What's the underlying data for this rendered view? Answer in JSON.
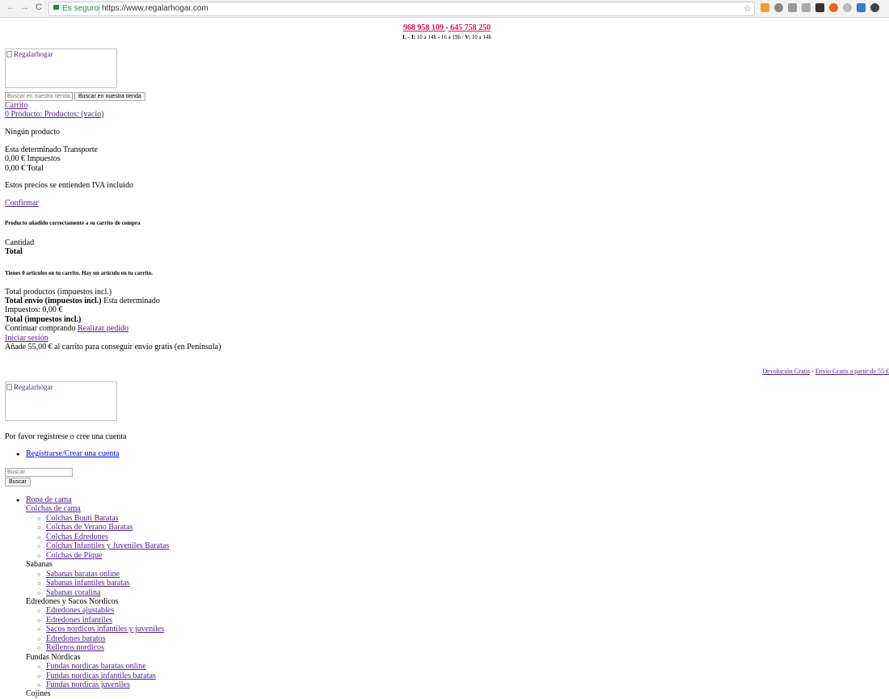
{
  "browser": {
    "secure_label": "Es seguro",
    "url": "https://www.regalarhogar.com",
    "nav_back": "←",
    "nav_forward": "→",
    "nav_reload": "C"
  },
  "header": {
    "phone1": "968 958 109 ",
    "phone_sep": "-",
    "phone2": " 645 758 250 ",
    "hours_lj_label": "L - J:",
    "hours_lj": " 10 a 14h - 16 a 19h / ",
    "hours_v_label": "V:",
    "hours_v": " 10 a 14h"
  },
  "logo_alt": "Regalarhogar",
  "search_top": {
    "placeholder": "Buscar en nuestra tienda",
    "button": "Buscar en nuestra tienda"
  },
  "cart": {
    "title": "Carrito",
    "summary": "0 Producto: Productos: (vacío)",
    "empty": "Ningún producto",
    "shipping": "Esta determinado Transporte",
    "taxes": "0,00 € Impuestos",
    "total": "0,00 € Total",
    "iva_note": "Estos precios se entienden IVA incluído",
    "confirm": "Confirmar"
  },
  "layer": {
    "added": "Producto añadido correctamente a su carrito de compra",
    "quantity": "Cantidad",
    "total": "Total",
    "items_msg": "Tienes 0 artículos en tu carrito. Hay un artículo en tu carrito.",
    "total_products": "Total productos (impuestos incl.)",
    "total_shipping_label": "Total envío (impuestos incl.)",
    "total_shipping_value": " Esta determinado",
    "taxes": "Impuestos: 0,00 €",
    "total_tax_incl": "Total (impuestos incl.)",
    "continue": "Continuar comprando ",
    "checkout": "Realizar pedido",
    "login": "Iniciar sesión",
    "free_shipping": "Añade 55,00 € al carrito para conseguir envío gratis (en Península)"
  },
  "promo": {
    "returns": "Devolución Gratis",
    "sep": " - ",
    "shipping": "Envío Gratis a partir de 55 €"
  },
  "account": {
    "prompt": "Por favor regístrese o cree una cuenta",
    "register": "Registrarse/Crear una cuenta"
  },
  "search_side": {
    "placeholder": "Buscar",
    "button": "Buscar"
  },
  "menu": {
    "root": "Ropa de cama",
    "groups": [
      {
        "title": "Colchas de cama",
        "link": true,
        "items": [
          "Colchas Bouti Baratas",
          "Colchas de Verano Baratas",
          "Colchas Edredones",
          "Colchas Infantiles y Juveniles Baratas",
          "Colchas de Pique"
        ]
      },
      {
        "title": "Sabanas",
        "link": false,
        "items": [
          "Sabanas baratas online",
          "Sabanas infantiles baratas",
          "Sabanas coralina"
        ]
      },
      {
        "title": "Edredones y Sacos Nordicos",
        "link": false,
        "items": [
          "Edredones ajustables",
          "Edredones infantiles",
          "Sacos nordicos infantiles y juveniles",
          "Edredones baratos",
          "Rellenos nordicos"
        ]
      },
      {
        "title": "Fundas Nórdicas",
        "link": false,
        "items": [
          "Fundas nordicas baratas online",
          "Fundas nordicas infantiles baratas",
          "Fundas nordicas juveniles"
        ]
      },
      {
        "title": "Cojines",
        "link": false,
        "items": []
      }
    ]
  },
  "colors": {
    "link": "#551a8b",
    "phone": "#e0115f",
    "secure": "#1e8e3e"
  }
}
